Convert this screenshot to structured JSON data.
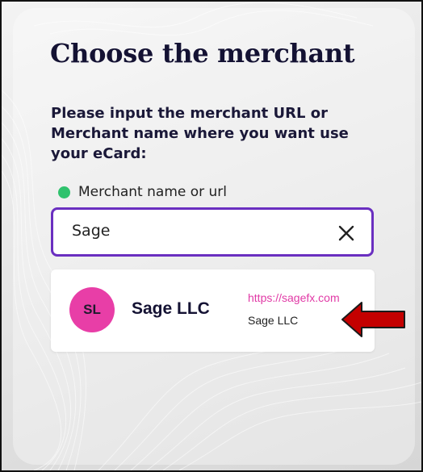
{
  "page": {
    "title": "Choose the merchant",
    "instructions": "Please input the merchant URL or Merchant name where you want use your eCard:"
  },
  "search": {
    "label": "Merchant name or url",
    "value": "Sage",
    "status_color": "#2fc26d",
    "clear_icon": "close-icon"
  },
  "results": [
    {
      "initials": "SL",
      "name": "Sage LLC",
      "url": "https://sagefx.com",
      "subtitle": "Sage LLC",
      "avatar_color": "#e83ea7"
    }
  ],
  "annotation": {
    "icon": "arrow-left-icon",
    "color": "#c40000"
  },
  "theme": {
    "accent": "#6a2fc0",
    "title_color": "#141233",
    "link_color": "#e13aa6"
  }
}
